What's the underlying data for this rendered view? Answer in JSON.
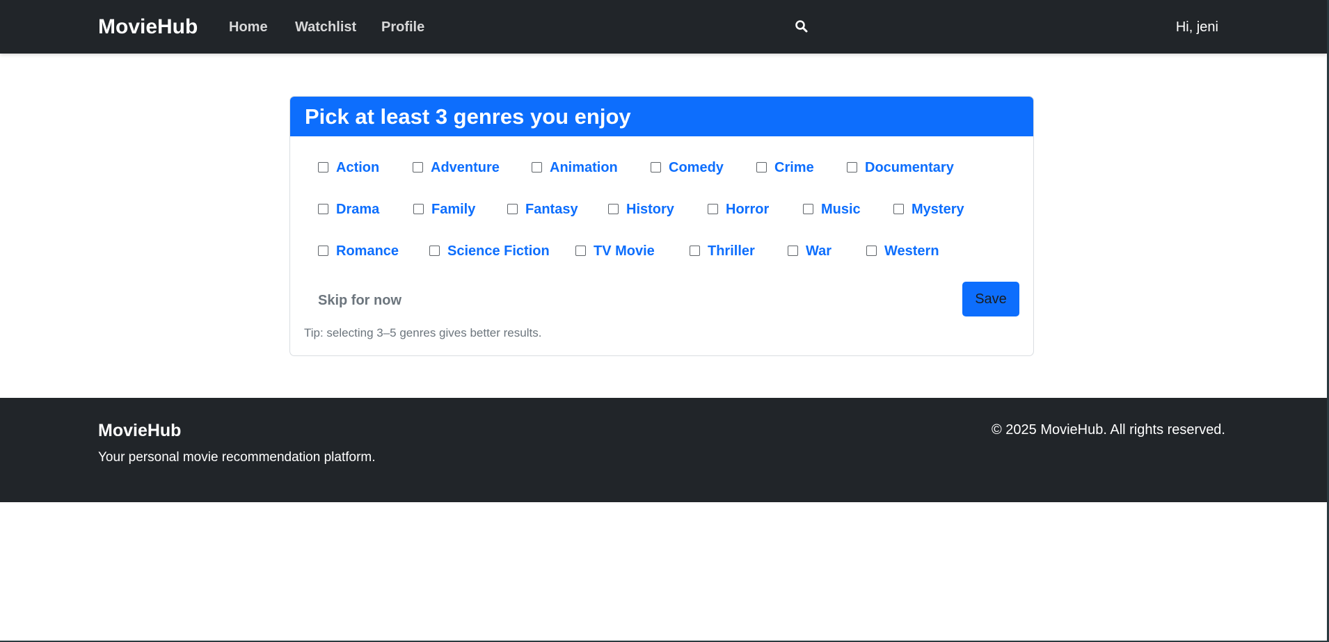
{
  "navbar": {
    "brand": "MovieHub",
    "links": {
      "home": "Home",
      "watchlist": "Watchlist",
      "profile": "Profile"
    },
    "search_icon": "search-icon",
    "greeting": "Hi, jeni"
  },
  "card": {
    "title": "Pick at least 3 genres you enjoy",
    "genres": [
      {
        "label": "Action",
        "checked": false
      },
      {
        "label": "Adventure",
        "checked": false
      },
      {
        "label": "Animation",
        "checked": false
      },
      {
        "label": "Comedy",
        "checked": false
      },
      {
        "label": "Crime",
        "checked": false
      },
      {
        "label": "Documentary",
        "checked": false
      },
      {
        "label": "Drama",
        "checked": false
      },
      {
        "label": "Family",
        "checked": false
      },
      {
        "label": "Fantasy",
        "checked": false
      },
      {
        "label": "History",
        "checked": false
      },
      {
        "label": "Horror",
        "checked": false
      },
      {
        "label": "Music",
        "checked": false
      },
      {
        "label": "Mystery",
        "checked": false
      },
      {
        "label": "Romance",
        "checked": false
      },
      {
        "label": "Science Fiction",
        "checked": false
      },
      {
        "label": "TV Movie",
        "checked": false
      },
      {
        "label": "Thriller",
        "checked": false
      },
      {
        "label": "War",
        "checked": false
      },
      {
        "label": "Western",
        "checked": false
      }
    ],
    "skip_label": "Skip for now",
    "save_label": "Save",
    "tip": "Tip: selecting 3–5 genres gives better results."
  },
  "footer": {
    "brand": "MovieHub",
    "tagline": "Your personal movie recommendation platform.",
    "copyright": "© 2025 MovieHub. All rights reserved."
  },
  "colors": {
    "navbar_bg": "#212529",
    "accent": "#0d6efd",
    "muted": "#6c757d"
  }
}
